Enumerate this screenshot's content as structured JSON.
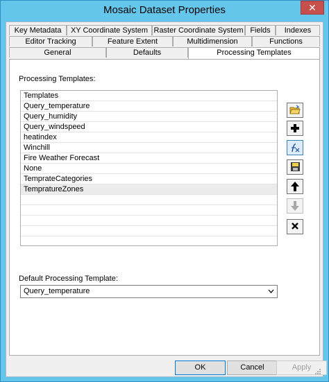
{
  "window": {
    "title": "Mosaic Dataset Properties",
    "close_glyph": "✕"
  },
  "tabs": {
    "row1": [
      "Key Metadata",
      "XY Coordinate System",
      "Raster Coordinate System",
      "Fields",
      "Indexes"
    ],
    "row2": [
      "Editor Tracking",
      "Feature Extent",
      "Multidimension",
      "Functions"
    ],
    "row3": [
      "General",
      "Defaults",
      "Processing Templates"
    ],
    "active": "Processing Templates"
  },
  "templates": {
    "label": "Processing Templates:",
    "header": "Templates",
    "items": [
      "Query_temperature",
      "Query_humidity",
      "Query_windspeed",
      "heatindex",
      "Winchill",
      "Fire Weather Forecast",
      "None",
      "TemprateCategories",
      "TempratureZones"
    ],
    "selected": "TempratureZones"
  },
  "side_buttons": [
    {
      "name": "open-folder-icon",
      "enabled": true
    },
    {
      "name": "add-icon",
      "enabled": true
    },
    {
      "name": "edit-function-icon",
      "enabled": true
    },
    {
      "name": "save-icon",
      "enabled": true
    },
    {
      "name": "move-up-icon",
      "enabled": true
    },
    {
      "name": "move-down-icon",
      "enabled": false
    },
    {
      "name": "remove-icon",
      "enabled": true
    }
  ],
  "default_template": {
    "label": "Default Processing Template:",
    "value": "Query_temperature"
  },
  "buttons": {
    "ok": "OK",
    "cancel": "Cancel",
    "apply": "Apply"
  },
  "colors": {
    "title_bar": "#65c6ec",
    "close_button": "#c7504c",
    "selected_row": "#ececec"
  }
}
